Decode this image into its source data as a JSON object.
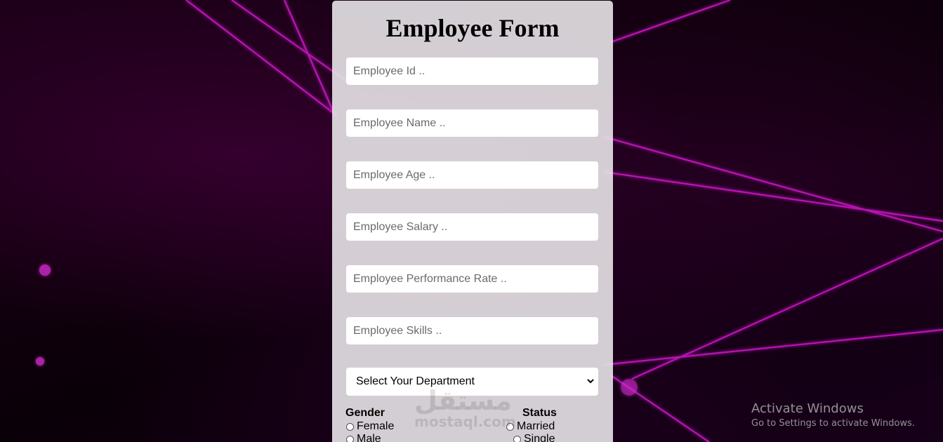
{
  "form": {
    "title": "Employee Form",
    "fields": [
      {
        "placeholder": "Employee Id .."
      },
      {
        "placeholder": "Employee Name .."
      },
      {
        "placeholder": "Employee Age .."
      },
      {
        "placeholder": "Employee Salary .."
      },
      {
        "placeholder": "Employee Performance Rate .."
      },
      {
        "placeholder": "Employee Skills .."
      }
    ],
    "department": {
      "selected": "Select Your Department"
    },
    "gender": {
      "label": "Gender",
      "options": [
        "Female",
        "Male"
      ]
    },
    "status": {
      "label": "Status",
      "options": [
        "Married",
        "Single"
      ]
    }
  },
  "watermark": {
    "arabic": "مستقل",
    "latin": "mostaql.com"
  },
  "os_overlay": {
    "line1": "Activate Windows",
    "line2": "Go to Settings to activate Windows."
  },
  "colors": {
    "background": "#12000f",
    "accent_neon": "#d01cc8",
    "card": "#e8e4e8"
  }
}
